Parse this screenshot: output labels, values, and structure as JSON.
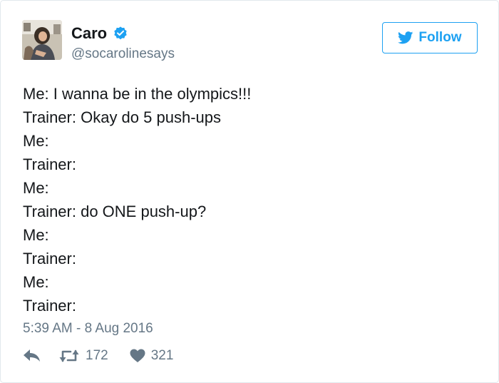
{
  "user": {
    "name": "Caro",
    "handle": "@socarolinesays"
  },
  "follow_label": "Follow",
  "tweet_lines": [
    "Me: I wanna be in the olympics!!!",
    "Trainer: Okay do 5 push-ups",
    "Me:",
    "Trainer:",
    "Me:",
    "Trainer: do ONE push-up?",
    "Me:",
    "Trainer:",
    "Me:",
    "Trainer:"
  ],
  "timestamp": "5:39 AM - 8 Aug 2016",
  "actions": {
    "retweet_count": "172",
    "like_count": "321"
  },
  "colors": {
    "accent": "#1da1f2",
    "secondary_text": "#657786",
    "icon_gray": "#657786"
  },
  "icons": [
    "avatar",
    "verified-badge-icon",
    "twitter-bird-icon",
    "reply-icon",
    "retweet-icon",
    "heart-icon"
  ]
}
